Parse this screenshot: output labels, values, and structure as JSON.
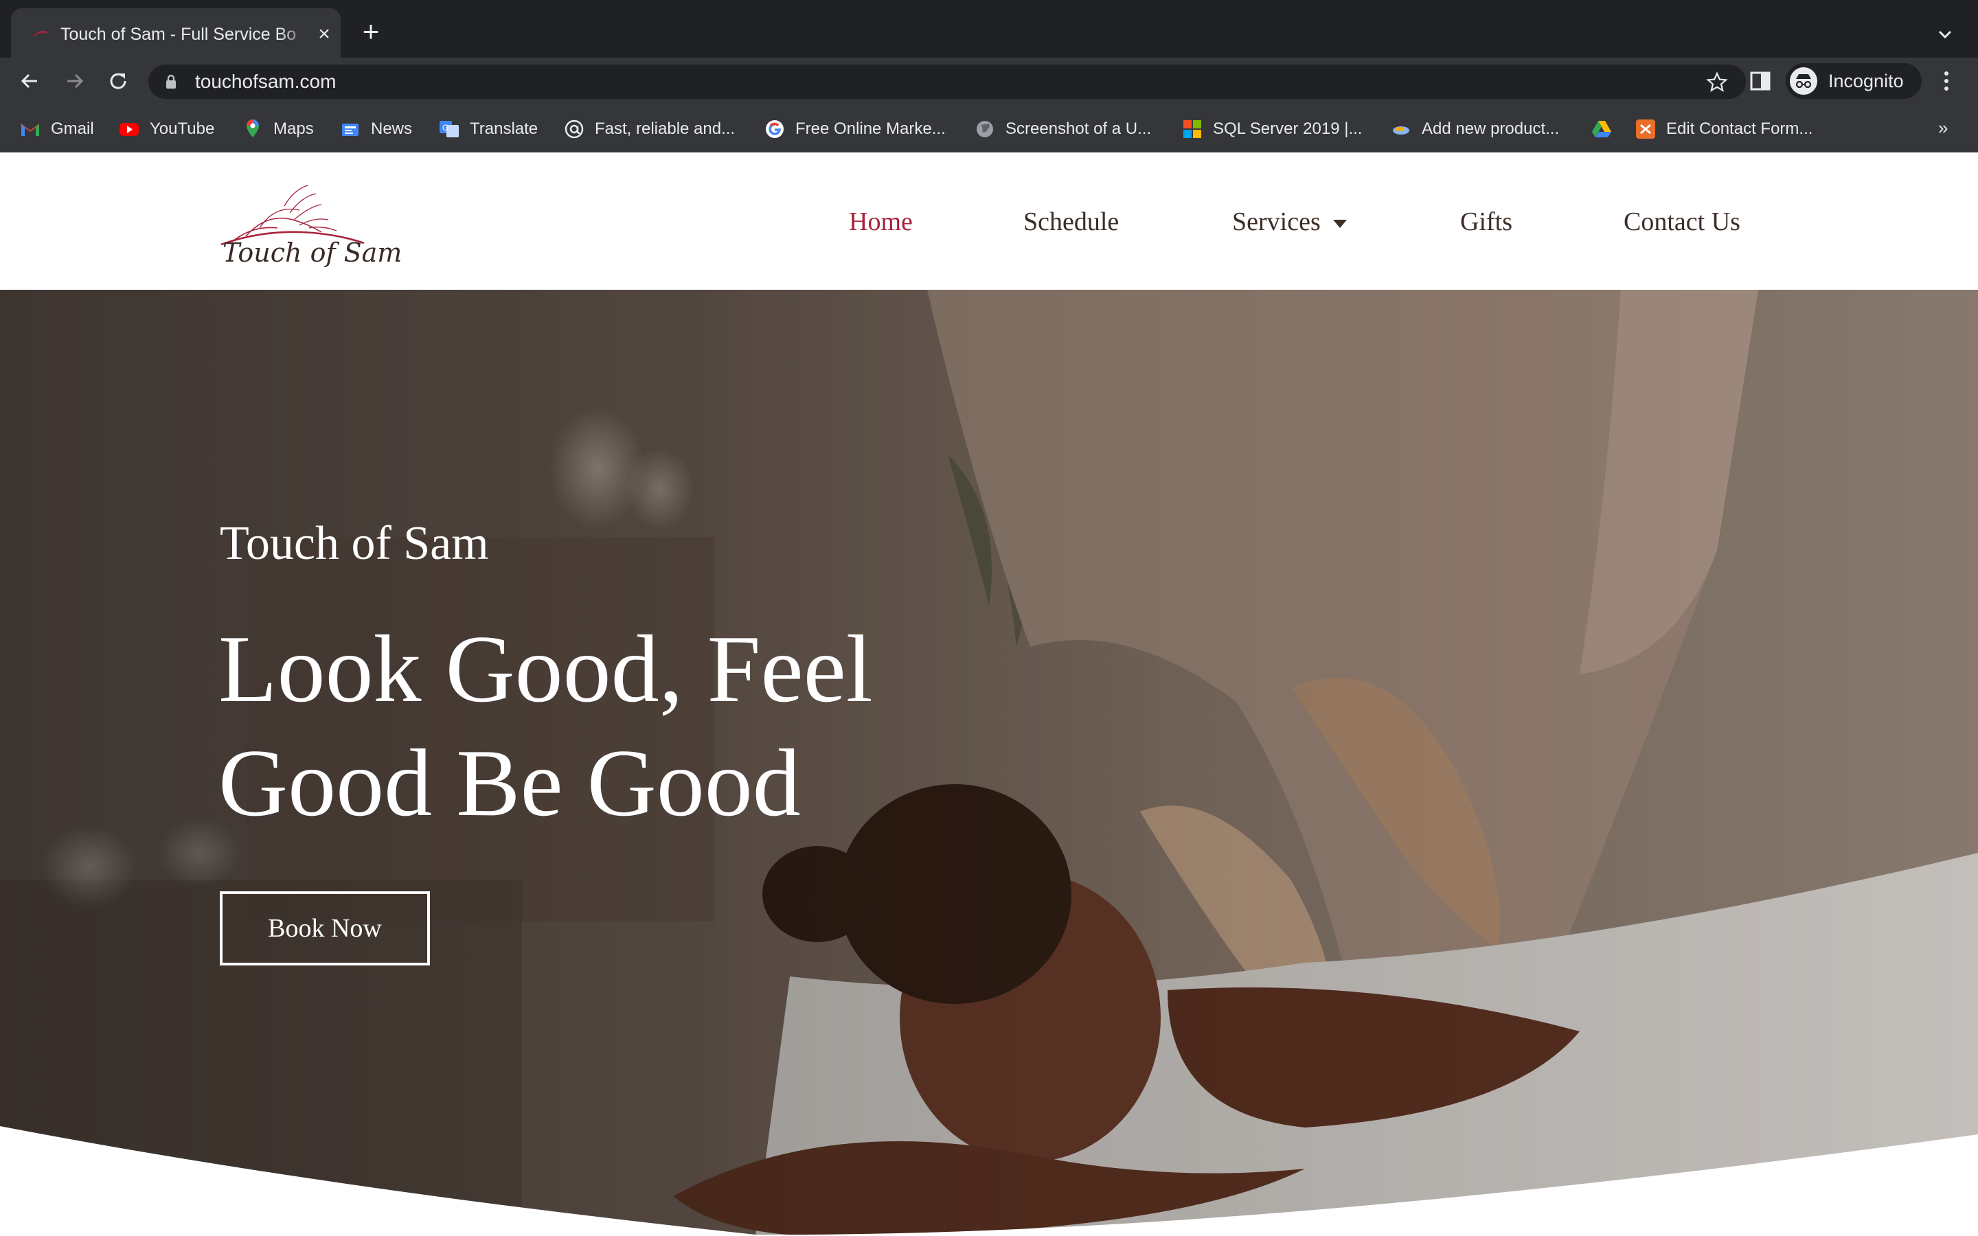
{
  "browser": {
    "tab_title": "Touch of Sam - Full Service Bo",
    "url": "touchofsam.com",
    "profile_label": "Incognito",
    "bookmarks": [
      {
        "label": "Gmail",
        "icon": "gmail-icon"
      },
      {
        "label": "YouTube",
        "icon": "youtube-icon"
      },
      {
        "label": "Maps",
        "icon": "maps-icon"
      },
      {
        "label": "News",
        "icon": "news-icon"
      },
      {
        "label": "Translate",
        "icon": "translate-icon"
      },
      {
        "label": "Fast, reliable and...",
        "icon": "at-sign-icon"
      },
      {
        "label": "Free Online Marke...",
        "icon": "google-icon"
      },
      {
        "label": "Screenshot of a U...",
        "icon": "globe-icon"
      },
      {
        "label": "SQL Server 2019 |...",
        "icon": "microsoft-icon"
      },
      {
        "label": "Add new product...",
        "icon": "product-icon"
      },
      {
        "label": "",
        "icon": "drive-icon"
      },
      {
        "label": "Edit Contact Form...",
        "icon": "form-icon"
      }
    ],
    "more_bookmarks": "»"
  },
  "site": {
    "logo_text": "Touch of Sam",
    "nav": {
      "home": "Home",
      "schedule": "Schedule",
      "services": "Services",
      "gifts": "Gifts",
      "contact": "Contact Us"
    },
    "hero": {
      "kicker": "Touch of Sam",
      "title_line1": "Look Good, Feel",
      "title_line2": "Good Be Good",
      "cta": "Book Now"
    }
  },
  "colors": {
    "accent": "#a8223c",
    "nav_text": "#3d2e28",
    "chrome_dark": "#202124",
    "chrome_mid": "#35363a"
  }
}
